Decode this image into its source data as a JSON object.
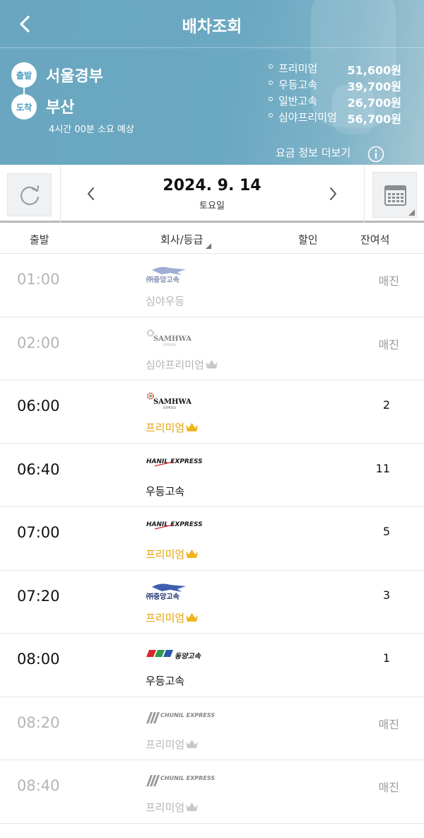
{
  "header": {
    "title": "배차조회",
    "departure_badge": "출발",
    "arrival_badge": "도착",
    "departure": "서울경부",
    "arrival": "부산",
    "duration": "4시간 00분 소요 예상",
    "fares": [
      {
        "grade": "프리미엄",
        "price": "51,600원"
      },
      {
        "grade": "우등고속",
        "price": "39,700원"
      },
      {
        "grade": "일반고속",
        "price": "26,700원"
      },
      {
        "grade": "심야프리미엄",
        "price": "56,700원"
      }
    ],
    "fare_more": "요금 정보 더보기"
  },
  "date": {
    "value": "2024. 9. 14",
    "weekday": "토요일"
  },
  "table_header": {
    "departure": "출발",
    "company_grade": "회사/등급",
    "discount": "할인",
    "seats": "잔여석"
  },
  "colors": {
    "header_bg": "#6aa6bf",
    "premium_gold": "#e4a20a",
    "soldout_gray": "#b5b5b5"
  },
  "rows": [
    {
      "time": "01:00",
      "company_logo": "jungang-logo",
      "company_text": "㈜중앙고속",
      "grade": "심야우등",
      "premium": false,
      "seats": "매진",
      "soldout": true
    },
    {
      "time": "02:00",
      "company_logo": "samhwa-logo",
      "company_text": "SAMHWA",
      "grade": "심야프리미엄",
      "premium": true,
      "seats": "매진",
      "soldout": true
    },
    {
      "time": "06:00",
      "company_logo": "samhwa-logo",
      "company_text": "SAMHWA",
      "grade": "프리미엄",
      "premium": true,
      "seats": "2",
      "soldout": false
    },
    {
      "time": "06:40",
      "company_logo": "hanil-logo",
      "company_text": "HANIL EXPRESS",
      "grade": "우등고속",
      "premium": false,
      "seats": "11",
      "soldout": false
    },
    {
      "time": "07:00",
      "company_logo": "hanil-logo",
      "company_text": "HANIL EXPRESS",
      "grade": "프리미엄",
      "premium": true,
      "seats": "5",
      "soldout": false
    },
    {
      "time": "07:20",
      "company_logo": "jungang-logo",
      "company_text": "㈜중앙고속",
      "grade": "프리미엄",
      "premium": true,
      "seats": "3",
      "soldout": false
    },
    {
      "time": "08:00",
      "company_logo": "dongyang-logo",
      "company_text": "동양고속",
      "grade": "우등고속",
      "premium": false,
      "seats": "1",
      "soldout": false
    },
    {
      "time": "08:20",
      "company_logo": "chunil-logo",
      "company_text": "CHUNIL EXPRESS",
      "grade": "프리미엄",
      "premium": true,
      "seats": "매진",
      "soldout": true
    },
    {
      "time": "08:40",
      "company_logo": "chunil-logo",
      "company_text": "CHUNIL EXPRESS",
      "grade": "프리미엄",
      "premium": true,
      "seats": "매진",
      "soldout": true
    }
  ]
}
